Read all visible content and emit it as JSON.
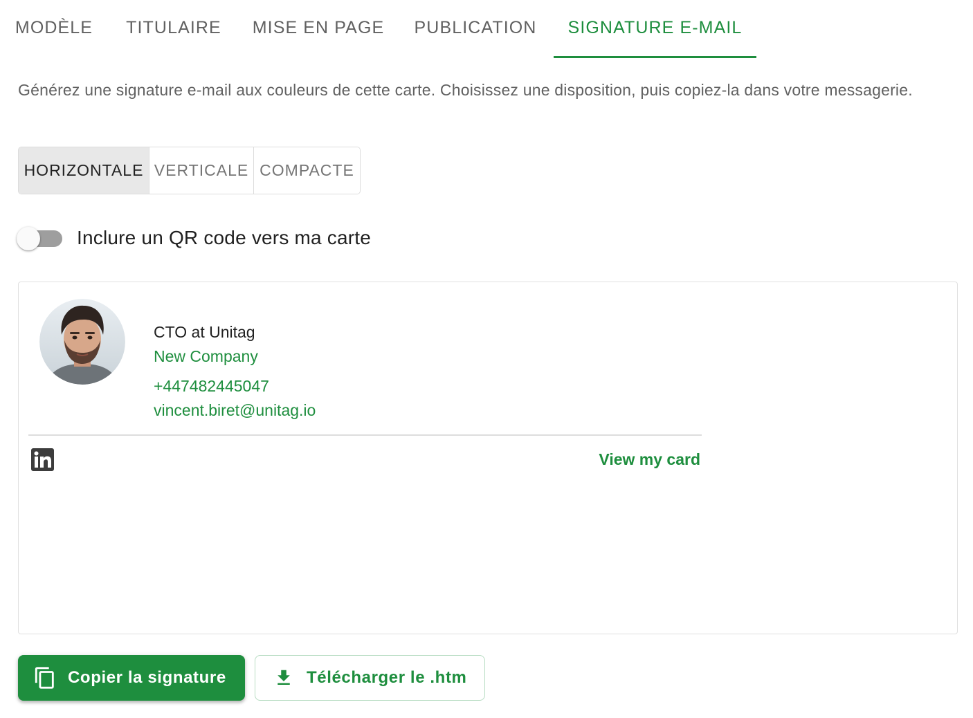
{
  "tabs": [
    {
      "label": "MODÈLE",
      "active": false
    },
    {
      "label": "TITULAIRE",
      "active": false
    },
    {
      "label": "MISE EN PAGE",
      "active": false
    },
    {
      "label": "PUBLICATION",
      "active": false
    },
    {
      "label": "SIGNATURE E-MAIL",
      "active": true
    }
  ],
  "description": "Générez une signature e-mail aux couleurs de cette carte. Choisissez une disposition, puis copiez-la dans votre messagerie.",
  "layouts": [
    {
      "label": "HORIZONTALE",
      "active": true
    },
    {
      "label": "VERTICALE",
      "active": false
    },
    {
      "label": "COMPACTE",
      "active": false
    }
  ],
  "qr_toggle": {
    "label": "Inclure un QR code vers ma carte",
    "checked": false
  },
  "signature": {
    "role": "CTO at Unitag",
    "company": "New Company",
    "phone": "+447482445047",
    "email": "vincent.biret@unitag.io",
    "social_icon": "linkedin-icon",
    "view_card_label": "View my card"
  },
  "actions": {
    "copy_label": "Copier la signature",
    "copy_icon": "copy-icon",
    "download_label": "Télécharger le .htm",
    "download_icon": "download-icon"
  },
  "colors": {
    "accent": "#1e8e3e",
    "text": "#212121",
    "muted": "#616161"
  }
}
